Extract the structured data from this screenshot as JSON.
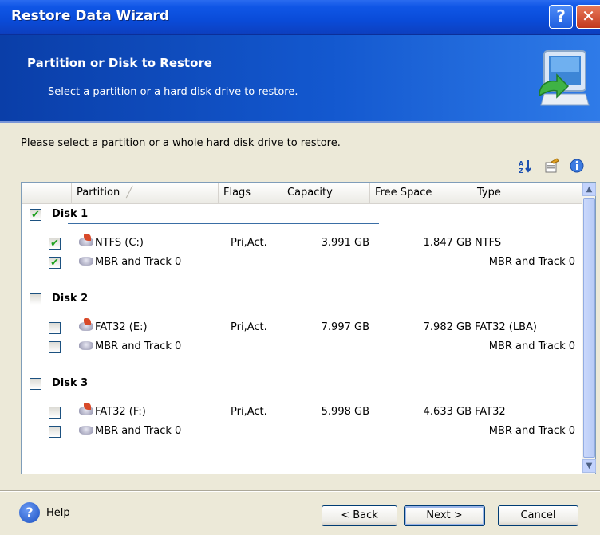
{
  "window": {
    "title": "Restore Data Wizard",
    "help_glyph": "?",
    "close_glyph": "✕"
  },
  "header": {
    "title": "Partition or Disk to Restore",
    "subtitle": "Select a partition or a hard disk drive to restore."
  },
  "instruction": "Please select a partition or a whole hard disk drive to restore.",
  "toolbar_icons": [
    "sort-icon",
    "properties-icon",
    "info-icon"
  ],
  "columns": {
    "partition": "Partition",
    "flags": "Flags",
    "capacity": "Capacity",
    "free": "Free Space",
    "type": "Type"
  },
  "disks": [
    {
      "label": "Disk 1",
      "checked": true,
      "partitions": [
        {
          "name": "NTFS (C:)",
          "flags": "Pri,Act.",
          "capacity": "3.991 GB",
          "free": "1.847 GB",
          "type": "NTFS",
          "checked": true,
          "icon": "partition-icon"
        },
        {
          "name": "MBR and Track 0",
          "flags": "",
          "capacity": "",
          "free": "",
          "type": "MBR and Track 0",
          "checked": true,
          "icon": "mbr-icon"
        }
      ]
    },
    {
      "label": "Disk 2",
      "checked": false,
      "partitions": [
        {
          "name": "FAT32 (E:)",
          "flags": "Pri,Act.",
          "capacity": "7.997 GB",
          "free": "7.982 GB",
          "type": "FAT32 (LBA)",
          "checked": false,
          "icon": "partition-icon"
        },
        {
          "name": "MBR and Track 0",
          "flags": "",
          "capacity": "",
          "free": "",
          "type": "MBR and Track 0",
          "checked": false,
          "icon": "mbr-icon"
        }
      ]
    },
    {
      "label": "Disk 3",
      "checked": false,
      "partitions": [
        {
          "name": "FAT32 (F:)",
          "flags": "Pri,Act.",
          "capacity": "5.998 GB",
          "free": "4.633 GB",
          "type": "FAT32",
          "checked": false,
          "icon": "partition-icon"
        },
        {
          "name": "MBR and Track 0",
          "flags": "",
          "capacity": "",
          "free": "",
          "type": "MBR and Track 0",
          "checked": false,
          "icon": "mbr-icon"
        }
      ]
    }
  ],
  "footer": {
    "help": "Help",
    "back": "< Back",
    "next": "Next >",
    "cancel": "Cancel"
  },
  "colors": {
    "title_bar": "#0a4bd8",
    "header": "#1358cf",
    "check": "#21a121"
  }
}
